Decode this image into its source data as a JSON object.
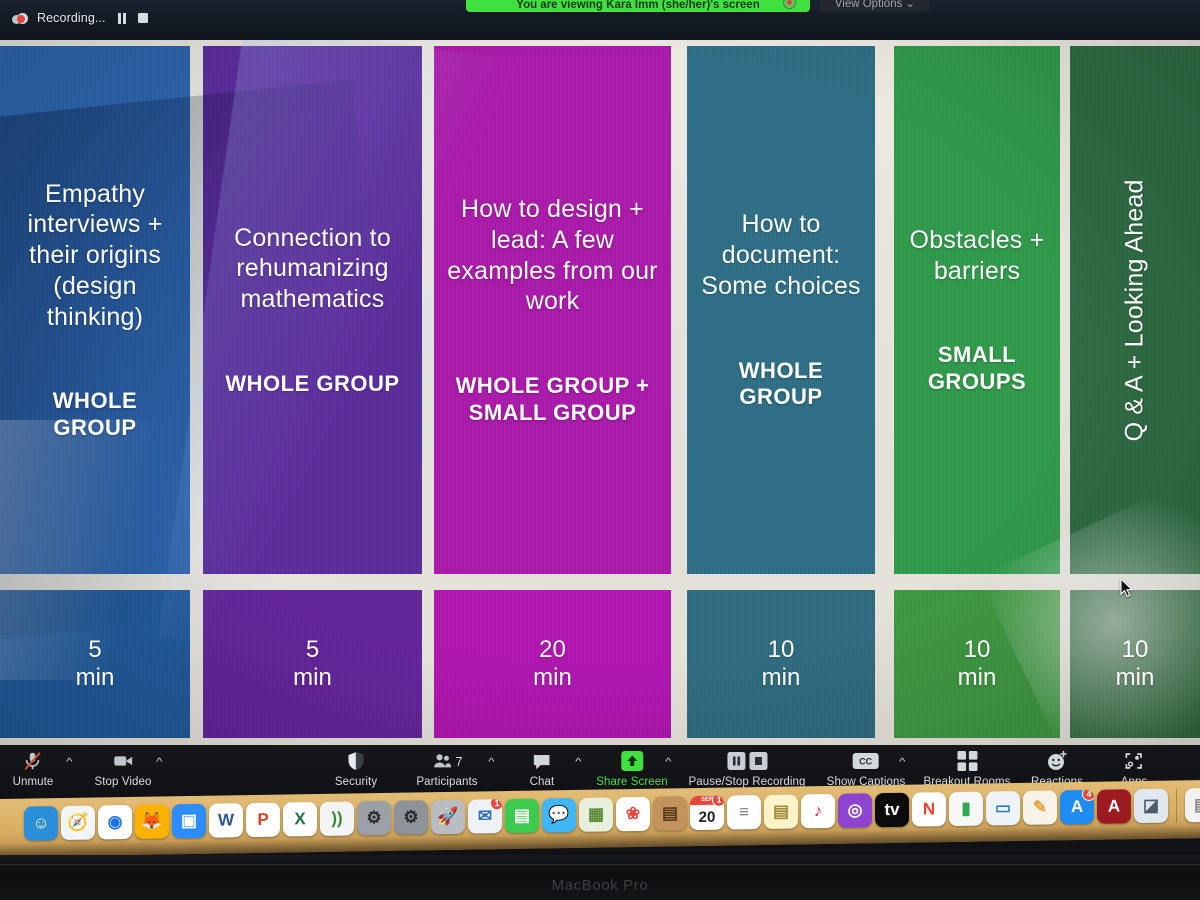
{
  "zoom_top_bar": {
    "recording_label": "Recording...",
    "recording_icon": "cloud-record-icon",
    "pause_icon": "pause-icon",
    "stop_icon": "stop-icon",
    "share_banner_text": "You are viewing Kara Imm (she/her)'s screen",
    "view_options_label": "View Options ⌄"
  },
  "slide": {
    "columns": [
      {
        "title": "Empathy interviews + their origins (design thinking)",
        "group": "WHOLE GROUP",
        "time": "5",
        "time_unit": "min",
        "color": "#2a64ad",
        "time_color": "#1e5a9e",
        "vertical": false
      },
      {
        "title": "Connection to rehumanizing mathematics",
        "group": "WHOLE GROUP",
        "time": "5",
        "time_unit": "min",
        "color": "#5a2b9c",
        "time_color": "#63229c",
        "vertical": false
      },
      {
        "title": "How to design + lead: A few examples from our work",
        "group": "WHOLE GROUP + SMALL GROUP",
        "time": "20",
        "time_unit": "min",
        "color": "#ab18ab",
        "time_color": "#b114b1",
        "vertical": false
      },
      {
        "title": "How to document: Some choices",
        "group": "WHOLE GROUP",
        "time": "10",
        "time_unit": "min",
        "color": "#2d6e86",
        "time_color": "#2e6c81",
        "vertical": false
      },
      {
        "title": "Obstacles + barriers",
        "group": "SMALL GROUPS",
        "time": "10",
        "time_unit": "min",
        "color": "#2f9a4a",
        "time_color": "#3e9a41",
        "vertical": false
      },
      {
        "title": "Q & A + Looking Ahead",
        "group": "",
        "time": "10",
        "time_unit": "min",
        "color": "#2d6b42",
        "time_color": "#2f6b3e",
        "vertical": true
      }
    ]
  },
  "zoom_toolbar": {
    "items": [
      {
        "label": "Unmute",
        "icon": "mic-muted-icon",
        "caret": true,
        "highlight": false
      },
      {
        "label": "Stop Video",
        "icon": "video-camera-icon",
        "caret": true,
        "highlight": false
      },
      {
        "label": "Security",
        "icon": "shield-icon",
        "caret": false,
        "highlight": false
      },
      {
        "label": "Participants",
        "icon": "participants-icon",
        "caret": true,
        "highlight": false,
        "count": "7"
      },
      {
        "label": "Chat",
        "icon": "chat-bubble-icon",
        "caret": true,
        "highlight": false
      },
      {
        "label": "Share Screen",
        "icon": "share-screen-up-arrow-icon",
        "caret": true,
        "highlight": true
      },
      {
        "label": "Pause/Stop Recording",
        "icon": "pause-stop-recording-icon",
        "caret": false,
        "highlight": false
      },
      {
        "label": "Show Captions",
        "icon": "closed-captions-icon",
        "caret": true,
        "highlight": false
      },
      {
        "label": "Breakout Rooms",
        "icon": "breakout-rooms-grid-icon",
        "caret": false,
        "highlight": false
      },
      {
        "label": "Reactions",
        "icon": "reactions-smiley-icon",
        "caret": false,
        "highlight": false
      },
      {
        "label": "Apps",
        "icon": "apps-bracket-icon",
        "caret": false,
        "highlight": false
      }
    ]
  },
  "dock": {
    "items": [
      {
        "name": "finder-icon",
        "glyph": "☺",
        "bg": "#2a8fd8",
        "fg": "#ffffff",
        "running": true
      },
      {
        "name": "safari-icon",
        "glyph": "🧭",
        "bg": "#f2f6fa",
        "fg": "#1a6fd4",
        "running": false
      },
      {
        "name": "chrome-icon",
        "glyph": "◉",
        "bg": "#ffffff",
        "fg": "#1a73e8",
        "running": true
      },
      {
        "name": "firefox-icon",
        "glyph": "🦊",
        "bg": "#ffb300",
        "fg": "#ff5722",
        "running": false
      },
      {
        "name": "zoom-icon",
        "glyph": "▣",
        "bg": "#2d8cff",
        "fg": "#ffffff",
        "running": true
      },
      {
        "name": "word-icon",
        "glyph": "W",
        "bg": "#ffffff",
        "fg": "#2b579a",
        "running": true
      },
      {
        "name": "powerpoint-icon",
        "glyph": "P",
        "bg": "#ffffff",
        "fg": "#d24726",
        "running": false
      },
      {
        "name": "excel-icon",
        "glyph": "X",
        "bg": "#ffffff",
        "fg": "#217346",
        "running": false
      },
      {
        "name": "airplay-icon",
        "glyph": "))",
        "bg": "#f4f4f4",
        "fg": "#3a8a3a",
        "running": false
      },
      {
        "name": "system-settings-icon",
        "glyph": "⚙",
        "bg": "#9aa0a6",
        "fg": "#2b2b2b",
        "running": false
      },
      {
        "name": "system-preferences-icon",
        "glyph": "⚙",
        "bg": "#8d9399",
        "fg": "#26292c",
        "running": false
      },
      {
        "name": "launchpad-icon",
        "glyph": "🚀",
        "bg": "#b9bdc2",
        "fg": "#2b2b2b",
        "running": false
      },
      {
        "name": "mail-icon",
        "glyph": "✉",
        "bg": "#eef2f6",
        "fg": "#2f6fb5",
        "running": true,
        "badge": "1"
      },
      {
        "name": "facetime-icon",
        "glyph": "▤",
        "bg": "#3ccb4f",
        "fg": "#ffffff",
        "running": false
      },
      {
        "name": "messages-icon",
        "glyph": "💬",
        "bg": "#3fb6f5",
        "fg": "#ffffff",
        "running": false
      },
      {
        "name": "maps-icon",
        "glyph": "▦",
        "bg": "#e8f0dd",
        "fg": "#5a8a3a",
        "running": false
      },
      {
        "name": "photos-icon",
        "glyph": "❀",
        "bg": "#ffffff",
        "fg": "#e8453c",
        "running": false
      },
      {
        "name": "contacts-icon",
        "glyph": "▤",
        "bg": "#c2935c",
        "fg": "#5a3a18",
        "running": false
      },
      {
        "name": "calendar-icon",
        "glyph": "20",
        "bg": "#ffffff",
        "fg": "#2b2b2b",
        "running": false,
        "badge": "1",
        "header": "SEP"
      },
      {
        "name": "reminders-icon",
        "glyph": "≡",
        "bg": "#ffffff",
        "fg": "#7a7f85",
        "running": false
      },
      {
        "name": "notes-icon",
        "glyph": "▤",
        "bg": "#fdf3c8",
        "fg": "#9a8a3a",
        "running": false
      },
      {
        "name": "music-icon",
        "glyph": "♪",
        "bg": "#ffffff",
        "fg": "#fa2d48",
        "running": false
      },
      {
        "name": "podcasts-icon",
        "glyph": "◎",
        "bg": "#8e44d0",
        "fg": "#ffffff",
        "running": false
      },
      {
        "name": "apple-tv-icon",
        "glyph": "tv",
        "bg": "#0b0b0b",
        "fg": "#ffffff",
        "running": false
      },
      {
        "name": "news-icon",
        "glyph": "N",
        "bg": "#ffffff",
        "fg": "#f5402c",
        "running": false
      },
      {
        "name": "numbers-icon",
        "glyph": "▮",
        "bg": "#f7f7f7",
        "fg": "#2fa84f",
        "running": false
      },
      {
        "name": "keynote-icon",
        "glyph": "▭",
        "bg": "#eef3f7",
        "fg": "#2f7fd0",
        "running": false
      },
      {
        "name": "pages-icon",
        "glyph": "✎",
        "bg": "#f7f3e8",
        "fg": "#e8a33d",
        "running": false
      },
      {
        "name": "app-store-icon",
        "glyph": "A",
        "bg": "#1d8bf0",
        "fg": "#ffffff",
        "running": false,
        "badge": "4"
      },
      {
        "name": "adobe-acrobat-icon",
        "glyph": "A",
        "bg": "#9c1b20",
        "fg": "#ffffff",
        "running": true
      },
      {
        "name": "preview-icon",
        "glyph": "◪",
        "bg": "#dfe6ec",
        "fg": "#4a5a6a",
        "running": true
      },
      {
        "name": "document-1-icon",
        "glyph": "▤",
        "bg": "#f2f2f0",
        "fg": "#8a8a88",
        "running": false
      },
      {
        "name": "document-2-icon",
        "glyph": "▤",
        "bg": "#f2f2f0",
        "fg": "#8a8a88",
        "running": false
      }
    ]
  },
  "laptop": {
    "model_label": "MacBook Pro"
  }
}
